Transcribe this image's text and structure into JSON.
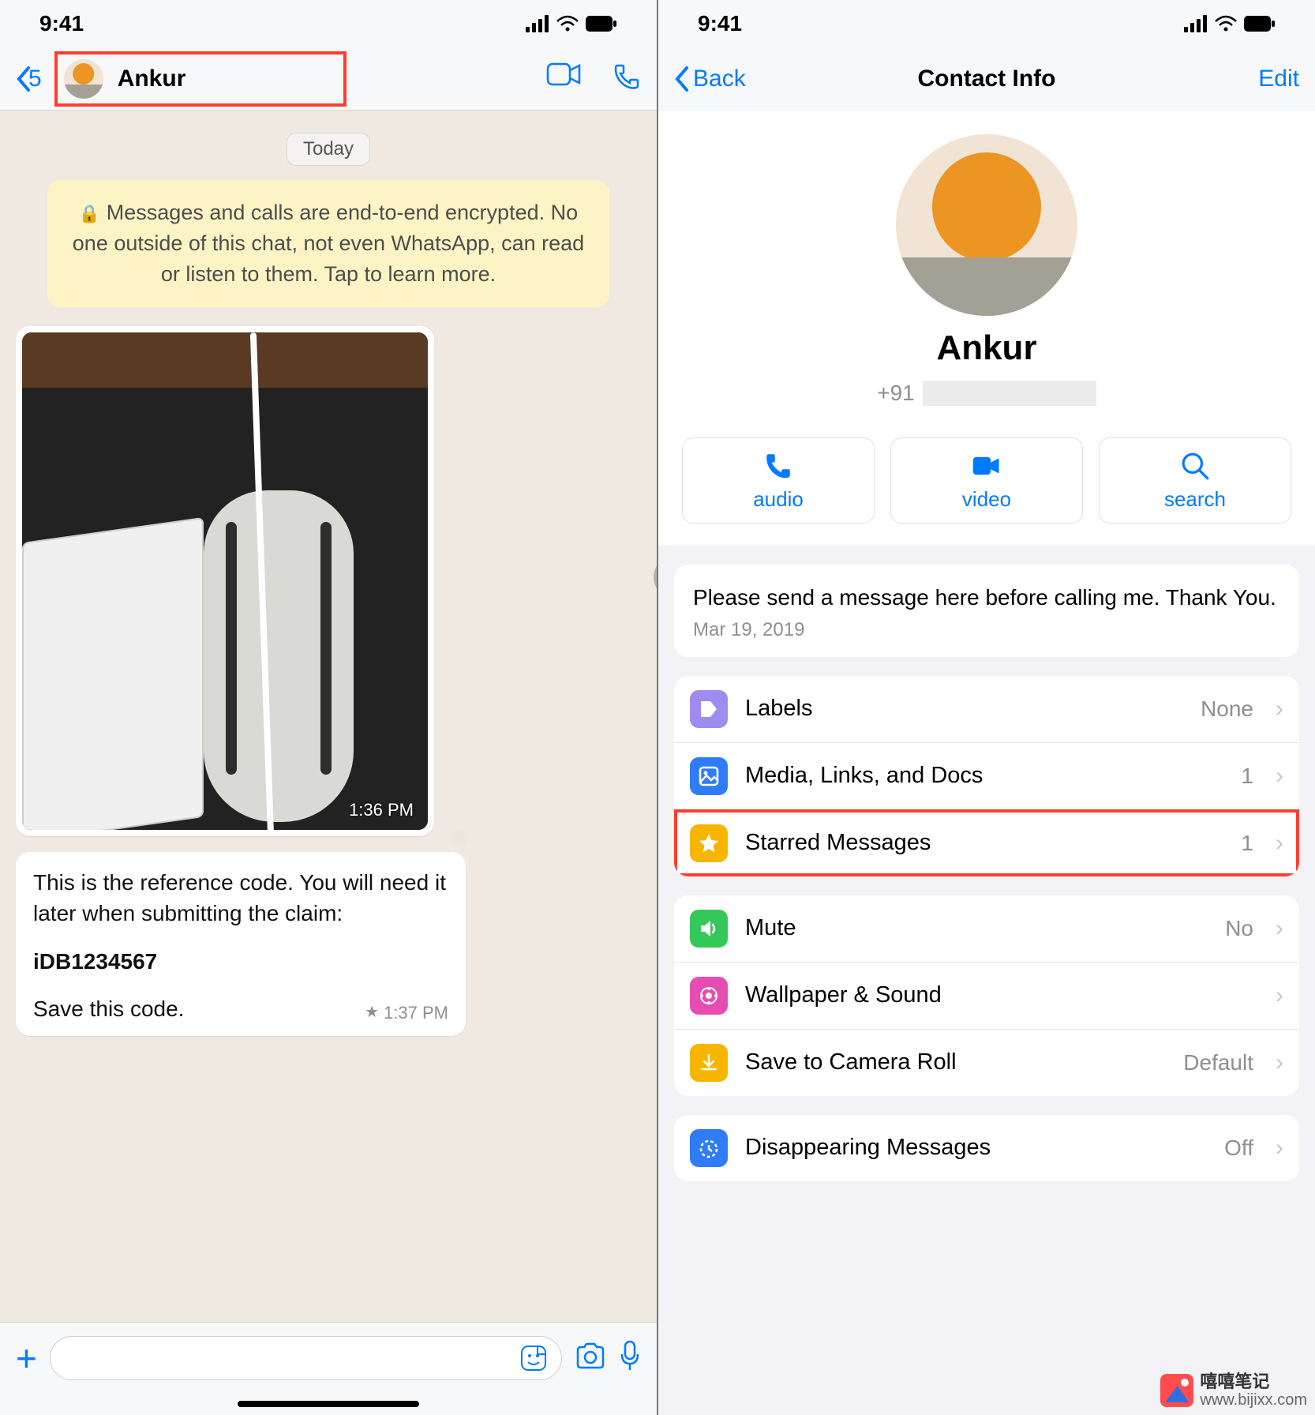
{
  "status": {
    "time": "9:41"
  },
  "left": {
    "back_count": "5",
    "contact_name": "Ankur",
    "date_label": "Today",
    "encryption_notice": "Messages and calls are end-to-end encrypted. No one outside of this chat, not even WhatsApp, can read or listen to them. Tap to learn more.",
    "photo_time": "1:36 PM",
    "message_text_1": "This is the reference code. You will need it later when submitting the claim:",
    "message_code": "iDB1234567",
    "message_text_2": "Save this code.",
    "message_time": "1:37 PM"
  },
  "right": {
    "back_label": "Back",
    "title": "Contact Info",
    "edit_label": "Edit",
    "contact_name": "Ankur",
    "phone_prefix": "+91",
    "actions": {
      "audio": "audio",
      "video": "video",
      "search": "search"
    },
    "about_text": "Please send a message here before calling me. Thank You.",
    "about_date": "Mar 19, 2019",
    "items1": [
      {
        "label": "Labels",
        "value": "None"
      },
      {
        "label": "Media, Links, and Docs",
        "value": "1"
      },
      {
        "label": "Starred Messages",
        "value": "1"
      }
    ],
    "items2": [
      {
        "label": "Mute",
        "value": "No"
      },
      {
        "label": "Wallpaper & Sound",
        "value": ""
      },
      {
        "label": "Save to Camera Roll",
        "value": "Default"
      }
    ],
    "items3": [
      {
        "label": "Disappearing Messages",
        "value": "Off"
      }
    ]
  },
  "watermark": {
    "name": "嘻嘻笔记",
    "url": "www.bijixx.com"
  }
}
